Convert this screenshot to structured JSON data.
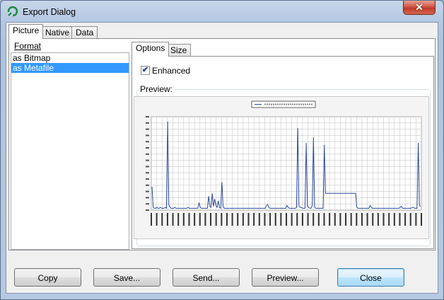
{
  "window": {
    "title": "Export Dialog",
    "close_glyph": "✕"
  },
  "main_tabs": [
    {
      "label": "Picture",
      "active": true
    },
    {
      "label": "Native",
      "active": false
    },
    {
      "label": "Data",
      "active": false
    }
  ],
  "format": {
    "label": "Format",
    "items": [
      {
        "label": "as Bitmap",
        "selected": false
      },
      {
        "label": "as Metafile",
        "selected": true
      }
    ]
  },
  "options_tabs": [
    {
      "label": "Options",
      "active": true
    },
    {
      "label": "Size",
      "active": false
    }
  ],
  "enhanced": {
    "label": "Enhanced",
    "checked": true
  },
  "preview": {
    "label": "Preview:"
  },
  "buttons": {
    "copy": "Copy",
    "save": "Save...",
    "send": "Send...",
    "preview": "Preview...",
    "close": "Close"
  },
  "chart_data": {
    "type": "line",
    "grid": true,
    "legend_position": "top-center",
    "line_color": "#2b4a9b",
    "y_tick_count": 15,
    "x_tick_count": 50,
    "ylim": [
      0,
      1
    ],
    "values": [
      0.25,
      0.03,
      0.02,
      0.02,
      0.03,
      0.02,
      0.02,
      0.03,
      0.02,
      0.02,
      0.02,
      0.03,
      0.02,
      0.95,
      0.05,
      0.03,
      0.02,
      0.02,
      0.02,
      0.03,
      0.02,
      0.02,
      0.02,
      0.02,
      0.02,
      0.02,
      0.02,
      0.02,
      0.02,
      0.02,
      0.03,
      0.02,
      0.02,
      0.02,
      0.02,
      0.02,
      0.02,
      0.02,
      0.02,
      0.08,
      0.03,
      0.02,
      0.02,
      0.02,
      0.02,
      0.02,
      0.02,
      0.15,
      0.04,
      0.03,
      0.18,
      0.04,
      0.12,
      0.05,
      0.03,
      0.1,
      0.03,
      0.02,
      0.3,
      0.04,
      0.02,
      0.02,
      0.02,
      0.02,
      0.02,
      0.02,
      0.02,
      0.02,
      0.02,
      0.02,
      0.02,
      0.02,
      0.02,
      0.02,
      0.02,
      0.02,
      0.02,
      0.02,
      0.02,
      0.02,
      0.02,
      0.02,
      0.02,
      0.02,
      0.02,
      0.02,
      0.02,
      0.02,
      0.02,
      0.02,
      0.02,
      0.02,
      0.02,
      0.02,
      0.02,
      0.05,
      0.06,
      0.03,
      0.02,
      0.02,
      0.02,
      0.02,
      0.02,
      0.02,
      0.02,
      0.02,
      0.02,
      0.02,
      0.02,
      0.02,
      0.02,
      0.02,
      0.05,
      0.03,
      0.02,
      0.02,
      0.02,
      0.02,
      0.02,
      0.02,
      0.03,
      0.88,
      0.04,
      0.03,
      0.03,
      0.02,
      0.02,
      0.02,
      0.72,
      0.04,
      0.03,
      0.02,
      0.02,
      0.05,
      0.78,
      0.03,
      0.02,
      0.02,
      0.02,
      0.02,
      0.02,
      0.02,
      0.02,
      0.7,
      0.18,
      0.18,
      0.18,
      0.18,
      0.18,
      0.18,
      0.18,
      0.18,
      0.18,
      0.18,
      0.18,
      0.18,
      0.18,
      0.18,
      0.18,
      0.18,
      0.18,
      0.18,
      0.18,
      0.18,
      0.18,
      0.18,
      0.18,
      0.18,
      0.18,
      0.18,
      0.03,
      0.02,
      0.02,
      0.02,
      0.02,
      0.02,
      0.02,
      0.02,
      0.02,
      0.02,
      0.02,
      0.05,
      0.03,
      0.02,
      0.02,
      0.02,
      0.02,
      0.02,
      0.02,
      0.02,
      0.02,
      0.02,
      0.02,
      0.02,
      0.02,
      0.02,
      0.02,
      0.02,
      0.02,
      0.02,
      0.02,
      0.02,
      0.02,
      0.02,
      0.02,
      0.02,
      0.03,
      0.04,
      0.02,
      0.02,
      0.02,
      0.02,
      0.02,
      0.02,
      0.02,
      0.02,
      0.03,
      0.03,
      0.02,
      0.02,
      0.02,
      0.72,
      0.05,
      0.04
    ]
  }
}
